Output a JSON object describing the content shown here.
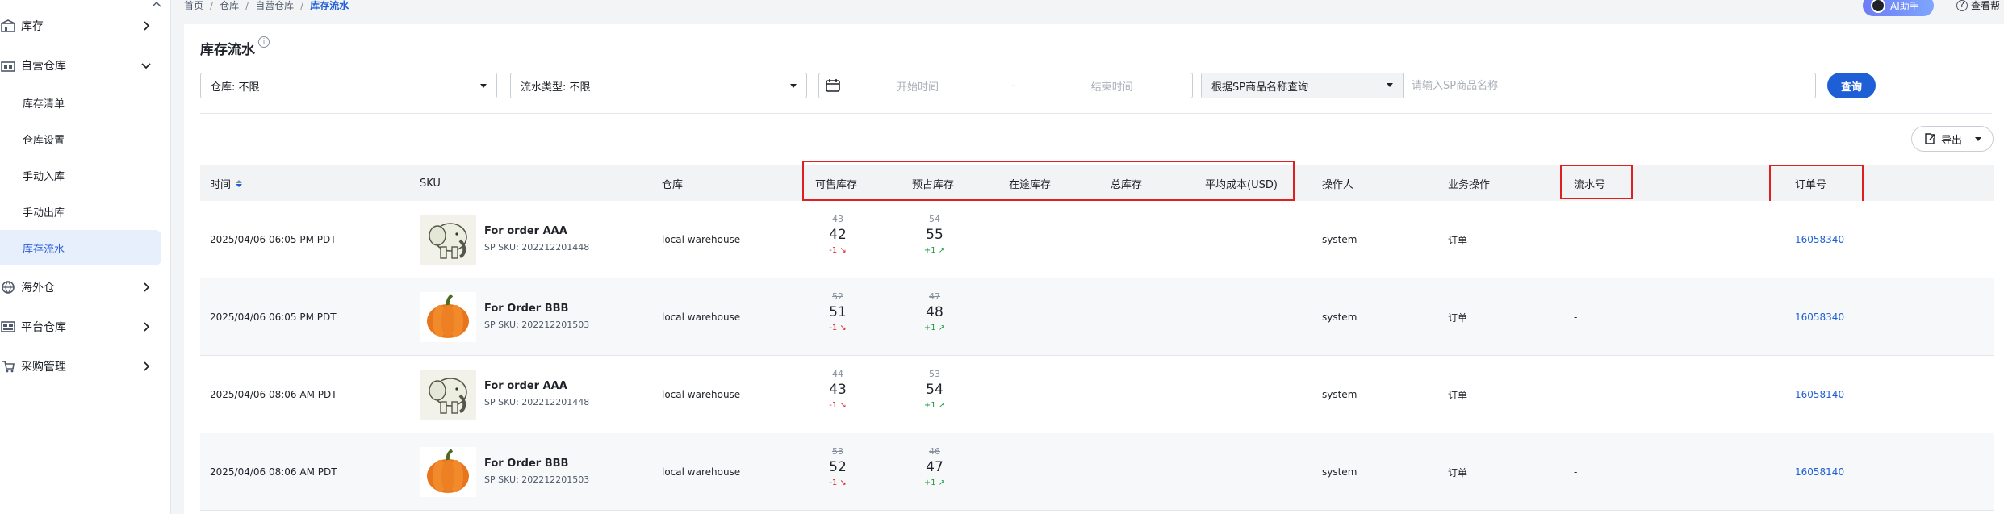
{
  "sidebar": {
    "groups": [
      {
        "label": "库存",
        "icon": "warehouse-icon"
      },
      {
        "label": "自营仓库",
        "icon": "self-warehouse-icon"
      },
      {
        "label": "海外仓",
        "icon": "overseas-warehouse-icon"
      },
      {
        "label": "平台仓库",
        "icon": "platform-warehouse-icon"
      },
      {
        "label": "采购管理",
        "icon": "purchase-icon"
      }
    ],
    "sub_items": [
      "库存清单",
      "仓库设置",
      "手动入库",
      "手动出库",
      "库存流水"
    ],
    "active_sub": "库存流水"
  },
  "breadcrumb": [
    "首页",
    "仓库",
    "自营仓库",
    "库存流水"
  ],
  "topbar": {
    "ai_label": "AI助手",
    "help_label": "查看帮"
  },
  "page": {
    "title": "库存流水"
  },
  "filters": {
    "warehouse": "仓库: 不限",
    "flow_type": "流水类型: 不限",
    "start_placeholder": "开始时间",
    "range_sep": "-",
    "end_placeholder": "结束时间",
    "search_mode": "根据SP商品名称查询",
    "search_placeholder": "请输入SP商品名称",
    "query_label": "查询",
    "export_label": "导出"
  },
  "table": {
    "headers": {
      "time": "时间",
      "sku": "SKU",
      "warehouse": "仓库",
      "available": "可售库存",
      "reserved": "预占库存",
      "in_transit": "在途库存",
      "total": "总库存",
      "avg_cost": "平均成本(USD)",
      "operator": "操作人",
      "operation": "业务操作",
      "flow_no": "流水号",
      "order_no": "订单号"
    },
    "rows": [
      {
        "time": "2025/04/06 06:05 PM PDT",
        "name": "For order AAA",
        "sku": "SP SKU: 202212201448",
        "image": "elephant",
        "warehouse": "local warehouse",
        "avail_old": "43",
        "avail_new": "42",
        "avail_chg": "-1",
        "res_old": "54",
        "res_new": "55",
        "res_chg": "+1",
        "operator": "system",
        "operation": "订单",
        "flow_no": "-",
        "order_no": "16058340"
      },
      {
        "time": "2025/04/06 06:05 PM PDT",
        "name": "For Order BBB",
        "sku": "SP SKU: 202212201503",
        "image": "pumpkin",
        "warehouse": "local warehouse",
        "avail_old": "52",
        "avail_new": "51",
        "avail_chg": "-1",
        "res_old": "47",
        "res_new": "48",
        "res_chg": "+1",
        "operator": "system",
        "operation": "订单",
        "flow_no": "-",
        "order_no": "16058340"
      },
      {
        "time": "2025/04/06 08:06 AM PDT",
        "name": "For order AAA",
        "sku": "SP SKU: 202212201448",
        "image": "elephant",
        "warehouse": "local warehouse",
        "avail_old": "44",
        "avail_new": "43",
        "avail_chg": "-1",
        "res_old": "53",
        "res_new": "54",
        "res_chg": "+1",
        "operator": "system",
        "operation": "订单",
        "flow_no": "-",
        "order_no": "16058140"
      },
      {
        "time": "2025/04/06 08:06 AM PDT",
        "name": "For Order BBB",
        "sku": "SP SKU: 202212201503",
        "image": "pumpkin",
        "warehouse": "local warehouse",
        "avail_old": "53",
        "avail_new": "52",
        "avail_chg": "-1",
        "res_old": "46",
        "res_new": "47",
        "res_chg": "+1",
        "operator": "system",
        "operation": "订单",
        "flow_no": "-",
        "order_no": "16058140"
      }
    ]
  },
  "colors": {
    "accent": "#1f5fd6",
    "highlight_box": "#e02020",
    "decrease": "#e02020",
    "increase": "#1a9a3e"
  }
}
